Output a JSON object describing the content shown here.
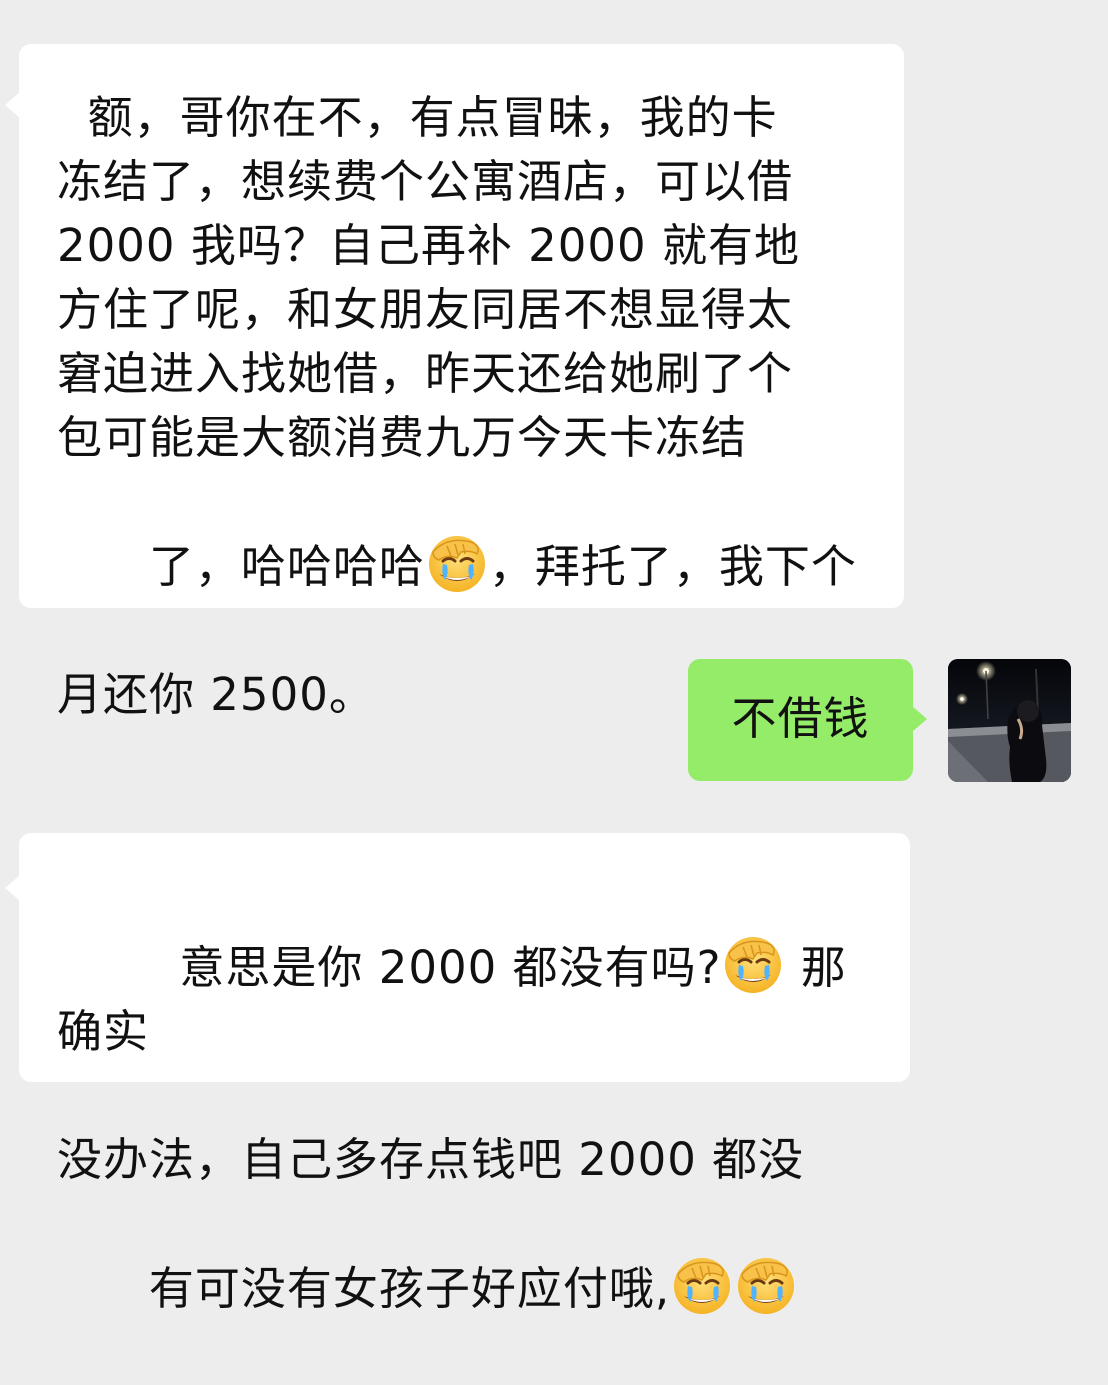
{
  "chat": {
    "messages": [
      {
        "side": "left",
        "lines": [
          "  额，哥你在不，有点冒昧，我的卡",
          "冻结了，想续费个公寓酒店，可以借",
          "2000 我吗？自己再补 2000 就有地",
          "方住了呢，和女朋友同居不想显得太",
          "窘迫进入找她借，昨天还给她刷了个",
          "包可能是大额消费九万今天卡冻结",
          "了，哈哈哈哈",
          "，拜托了，我下个",
          "月还你 2500。"
        ],
        "emoji_icon": "facepalm-crying-emoji"
      },
      {
        "side": "right",
        "text": "不借钱",
        "avatar_icon": "user-avatar-photo"
      },
      {
        "side": "left",
        "lines": [
          "  意思是你 2000 都没有吗?",
          " 那确实",
          "没办法，自己多存点钱吧 2000 都没",
          "有可没有女孩子好应付哦,"
        ],
        "emoji_icon": "facepalm-crying-emoji"
      }
    ]
  },
  "colors": {
    "background": "#ededed",
    "incoming_bubble": "#ffffff",
    "outgoing_bubble": "#95ec69",
    "text": "#111111"
  }
}
